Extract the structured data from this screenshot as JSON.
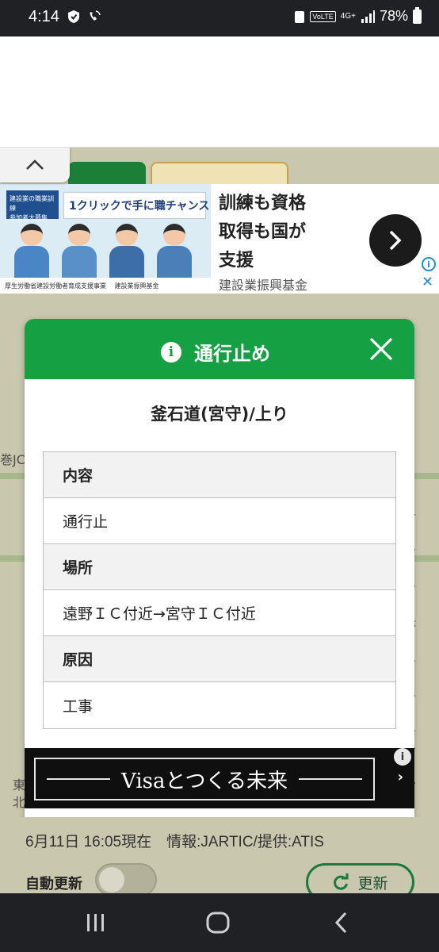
{
  "status_bar": {
    "time": "4:14",
    "network": "4G+",
    "volte": "VoLTE",
    "battery": "78%"
  },
  "ad": {
    "tag_line1": "建設業の職業訓練",
    "tag_line2": "参加者大募集",
    "slogan": "1クリックで手に職チャンス",
    "footer_left": "厚生労働省建設労働者育成支援事業",
    "footer_right": "建設業振興基金",
    "headline": [
      "訓練も資格",
      "取得も国が",
      "支援"
    ],
    "sponsor": "建設業振興基金"
  },
  "modal": {
    "title": "通行止め",
    "route": "釜石道(宮守)/上り",
    "rows": [
      {
        "label": "内容",
        "value": "通行止"
      },
      {
        "label": "場所",
        "value": "遠野ＩＣ付近→宮守ＩＣ付近"
      },
      {
        "label": "原因",
        "value": "工事"
      }
    ],
    "visa_ad": "Visaとつくる未来"
  },
  "footer": {
    "timestamp": "6月11日 16:05現在　情報:JARTIC/提供:ATIS",
    "auto_update_label": "自動更新",
    "auto_update_on": false,
    "refresh_label": "更新"
  },
  "background": {
    "labels": [
      "巻JCT",
      "東",
      "北"
    ]
  },
  "colors": {
    "header_green": "#14a043",
    "refresh_border": "#1b7a3c",
    "ad_link_blue": "#1a8fd0"
  }
}
